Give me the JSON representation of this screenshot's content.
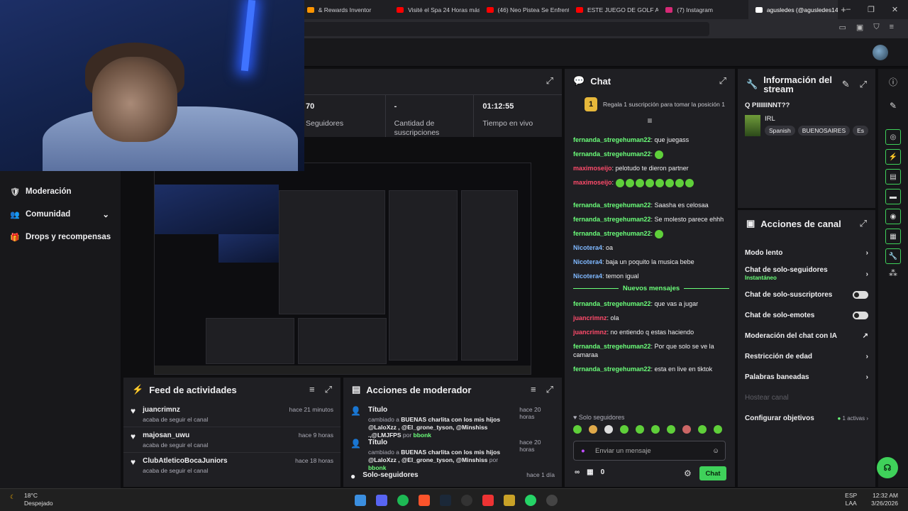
{
  "browser": {
    "tabs": [
      {
        "label": "& Rewards Inventor",
        "color": "#ff9500"
      },
      {
        "label": "Visité el Spa 24 Horas más",
        "color": "#ff0000"
      },
      {
        "label": "(46) Neo Pistea Se Enfrent",
        "color": "#ff0000"
      },
      {
        "label": "ESTE JUEGO DE GOLF ARI",
        "color": "#ff0000"
      },
      {
        "label": "(7) Instagram",
        "color": "#d62976"
      },
      {
        "label": "agusledes (@agusledes14",
        "color": "#ffffff"
      }
    ],
    "new_tab": "+",
    "window_buttons": [
      "–",
      "❐",
      "✕"
    ]
  },
  "stats": {
    "values": [
      {
        "value": "70",
        "label": "Seguidores"
      },
      {
        "value": "-",
        "label": "Cantidad de suscripciones"
      },
      {
        "value": "01:12:55",
        "label": "Tiempo en vivo"
      }
    ]
  },
  "sidebar": {
    "items": [
      {
        "label": "Moderación",
        "icon": "shield-icon"
      },
      {
        "label": "Comunidad",
        "icon": "community-icon"
      },
      {
        "label": "Drops y recompensas",
        "icon": "gift-icon"
      }
    ]
  },
  "chat": {
    "title": "Chat",
    "pinned": "Regala 1 suscripción para tomar la posición 1",
    "pin_rank": "1",
    "messages": [
      {
        "user": "fernanda_stregehuman22",
        "color": "green",
        "text": ": que juegass"
      },
      {
        "user": "fernanda_stregehuman22",
        "color": "green",
        "text": ":"
      },
      {
        "user": "maximoseijo",
        "color": "red",
        "text": ": pelotudo te dieron partner"
      },
      {
        "user": "maximoseijo",
        "color": "red",
        "text": ":"
      },
      {
        "user": "fernanda_stregehuman22",
        "color": "green",
        "text": ": Saasha es celosaa"
      },
      {
        "user": "fernanda_stregehuman22",
        "color": "green",
        "text": ": Se molesto parece ehhh"
      },
      {
        "user": "fernanda_stregehuman22",
        "color": "green",
        "text": ":"
      },
      {
        "user": "Nicotera4",
        "color": "blue",
        "text": ": oa"
      },
      {
        "user": "Nicotera4",
        "color": "blue",
        "text": ": baja un poquito la musica bebe"
      },
      {
        "user": "Nicotera4",
        "color": "blue",
        "text": ": temon igual"
      }
    ],
    "new_messages_label": "Nuevos mensajes",
    "messages_new": [
      {
        "user": "fernanda_stregehuman22",
        "color": "green",
        "text": ": que vas a jugar"
      },
      {
        "user": "juancrimnz",
        "color": "red",
        "text": ": ola"
      },
      {
        "user": "juancrimnz",
        "color": "red",
        "text": ": no entiendo q estas haciendo"
      },
      {
        "user": "fernanda_stregehuman22",
        "color": "green",
        "text": ": Por que solo se ve la camaraa"
      },
      {
        "user": "fernanda_stregehuman22",
        "color": "green",
        "text": ": esta en live en tiktok"
      }
    ],
    "followers_only": "Solo seguidores",
    "input_placeholder": "Enviar un mensaje",
    "points": "0",
    "send_label": "Chat"
  },
  "info": {
    "title": "Información del stream",
    "stream_title": "Q PIIIIIINNT??",
    "category": "IRL",
    "tags": [
      "Spanish",
      "BUENOSAIRES",
      "Es"
    ]
  },
  "actions": {
    "title": "Acciones de canal",
    "rows": [
      {
        "label": "Modo lento",
        "type": "chevron"
      },
      {
        "label": "Chat de solo-seguidores",
        "sub": "Instantáneo",
        "type": "chevron"
      },
      {
        "label": "Chat de solo-suscriptores",
        "type": "toggle"
      },
      {
        "label": "Chat de solo-emotes",
        "type": "toggle"
      },
      {
        "label": "Moderación del chat con IA",
        "type": "external"
      },
      {
        "label": "Restricción de edad",
        "type": "chevron"
      },
      {
        "label": "Palabras baneadas",
        "type": "chevron"
      },
      {
        "label": "Hostear canal",
        "type": "disabled"
      },
      {
        "label": "Configurar objetivos",
        "extra": "1 activas",
        "type": "chevron"
      }
    ]
  },
  "feed": {
    "title": "Feed de actividades",
    "rows": [
      {
        "name": "juancrimnz",
        "desc": "acaba de seguir el canal",
        "time": "hace 21 minutos"
      },
      {
        "name": "majosan_uwu",
        "desc": "acaba de seguir el canal",
        "time": "hace 9 horas"
      },
      {
        "name": "ClubAtleticoBocaJuniors",
        "desc": "acaba de seguir el canal",
        "time": "hace 18 horas"
      }
    ]
  },
  "mod": {
    "title": "Acciones de moderador",
    "rows": [
      {
        "name": "Título",
        "desc_pre": "cambiado a ",
        "desc": "BUENAS charlita con los mis hijos @LaloXzz , @El_grone_tyson, @Minshiss .,@LMJFPS",
        "by_pre": " por ",
        "by": "bbonk",
        "time": "hace 20 horas"
      },
      {
        "name": "Título",
        "desc_pre": "cambiado a ",
        "desc": "BUENAS charlita con los mis hijos @LaloXzz , @El_grone_tyson, @Minshiss",
        "by_pre": " por ",
        "by": "bbonk",
        "time": "hace 20 horas"
      },
      {
        "name": "Solo-seguidores",
        "time": "hace 1 día"
      }
    ]
  },
  "taskbar": {
    "temp": "18°C",
    "weather": "Despejado",
    "lang": "ESP",
    "lang2": "LAA",
    "time": "12:32 AM",
    "date": "3/26/2026"
  }
}
